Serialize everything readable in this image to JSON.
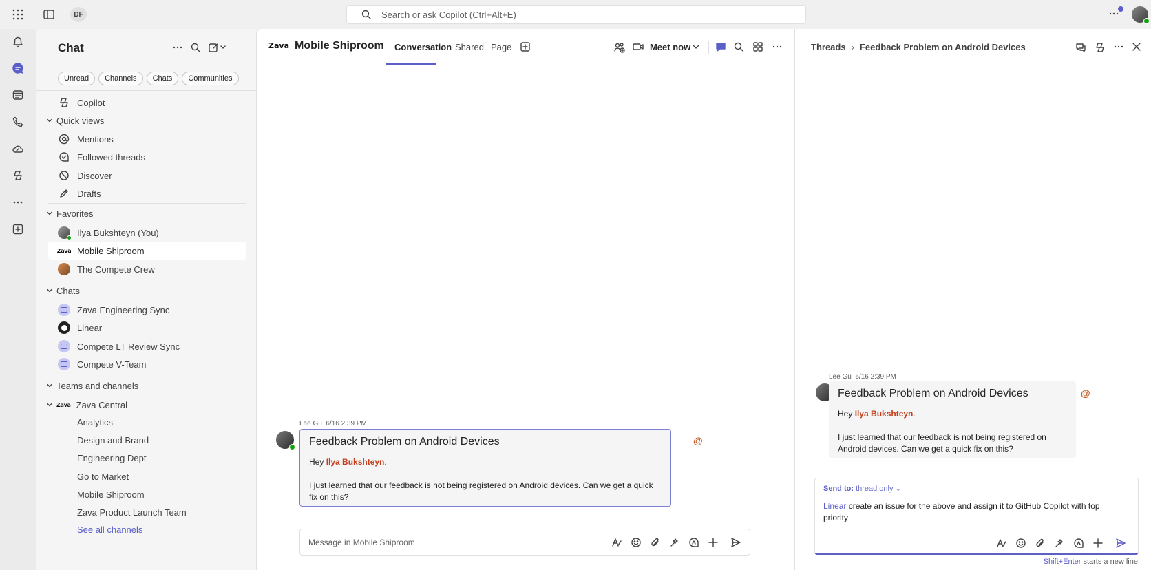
{
  "topbar": {
    "user_initials": "DF",
    "search_placeholder": "Search or ask Copilot (Ctrl+Alt+E)"
  },
  "rail": {
    "items": [
      "activity",
      "chat",
      "calendar",
      "calls",
      "onedrive",
      "copilot",
      "more",
      "add-apps"
    ]
  },
  "chatlist": {
    "title": "Chat",
    "filters": [
      "Unread",
      "Channels",
      "Chats",
      "Communities"
    ],
    "copilot": "Copilot",
    "quick_views": {
      "label": "Quick views",
      "items": [
        "Mentions",
        "Followed threads",
        "Discover",
        "Drafts"
      ]
    },
    "favorites": {
      "label": "Favorites",
      "items": [
        "Ilya Bukshteyn (You)",
        "Mobile Shiproom",
        "The Compete Crew"
      ]
    },
    "chats": {
      "label": "Chats",
      "items": [
        "Zava Engineering Sync",
        "Linear",
        "Compete LT Review Sync",
        "Compete V-Team"
      ]
    },
    "teams": {
      "label": "Teams and channels",
      "team_name": "Zava Central",
      "channels": [
        "Analytics",
        "Design and Brand",
        "Engineering Dept",
        "Go to Market",
        "Mobile Shiproom",
        "Zava Product Launch Team"
      ],
      "see_all": "See all channels"
    }
  },
  "channel": {
    "logo_text": "Zava",
    "title": "Mobile Shiproom",
    "tabs": [
      "Conversation",
      "Shared",
      "Page"
    ],
    "meet_now": "Meet now",
    "message": {
      "author": "Lee Gu",
      "time": "6/16 2:39 PM",
      "subject": "Feedback Problem on Android Devices",
      "greeting": "Hey",
      "mention": "Ilya Bukshteyn",
      "greeting_end": ".",
      "body": "I just learned that our feedback is not being registered on Android devices. Can we get a quick fix on this?"
    },
    "composer_placeholder": "Message in Mobile Shiproom"
  },
  "thread": {
    "breadcrumb_root": "Threads",
    "breadcrumb_current": "Feedback Problem on Android Devices",
    "message": {
      "author": "Lee Gu",
      "time": "6/16 2:39 PM",
      "subject": "Feedback Problem on Android Devices",
      "greeting": "Hey",
      "mention": "Ilya Bukshteyn",
      "greeting_end": ".",
      "body": "I just learned that our feedback is not being registered on Android devices. Can we get a quick fix on this?"
    },
    "reply": {
      "send_to_label": "Send to:",
      "send_to_value": "thread only",
      "app_mention": "Linear",
      "text": " create an issue for the above and assign it to GitHub Copilot with top priority"
    },
    "hint_key": "Shift+Enter",
    "hint_text": " starts a new line."
  },
  "colors": {
    "accent": "#5b5fc7",
    "mention": "#c43e1c",
    "presence": "#13a10e"
  }
}
